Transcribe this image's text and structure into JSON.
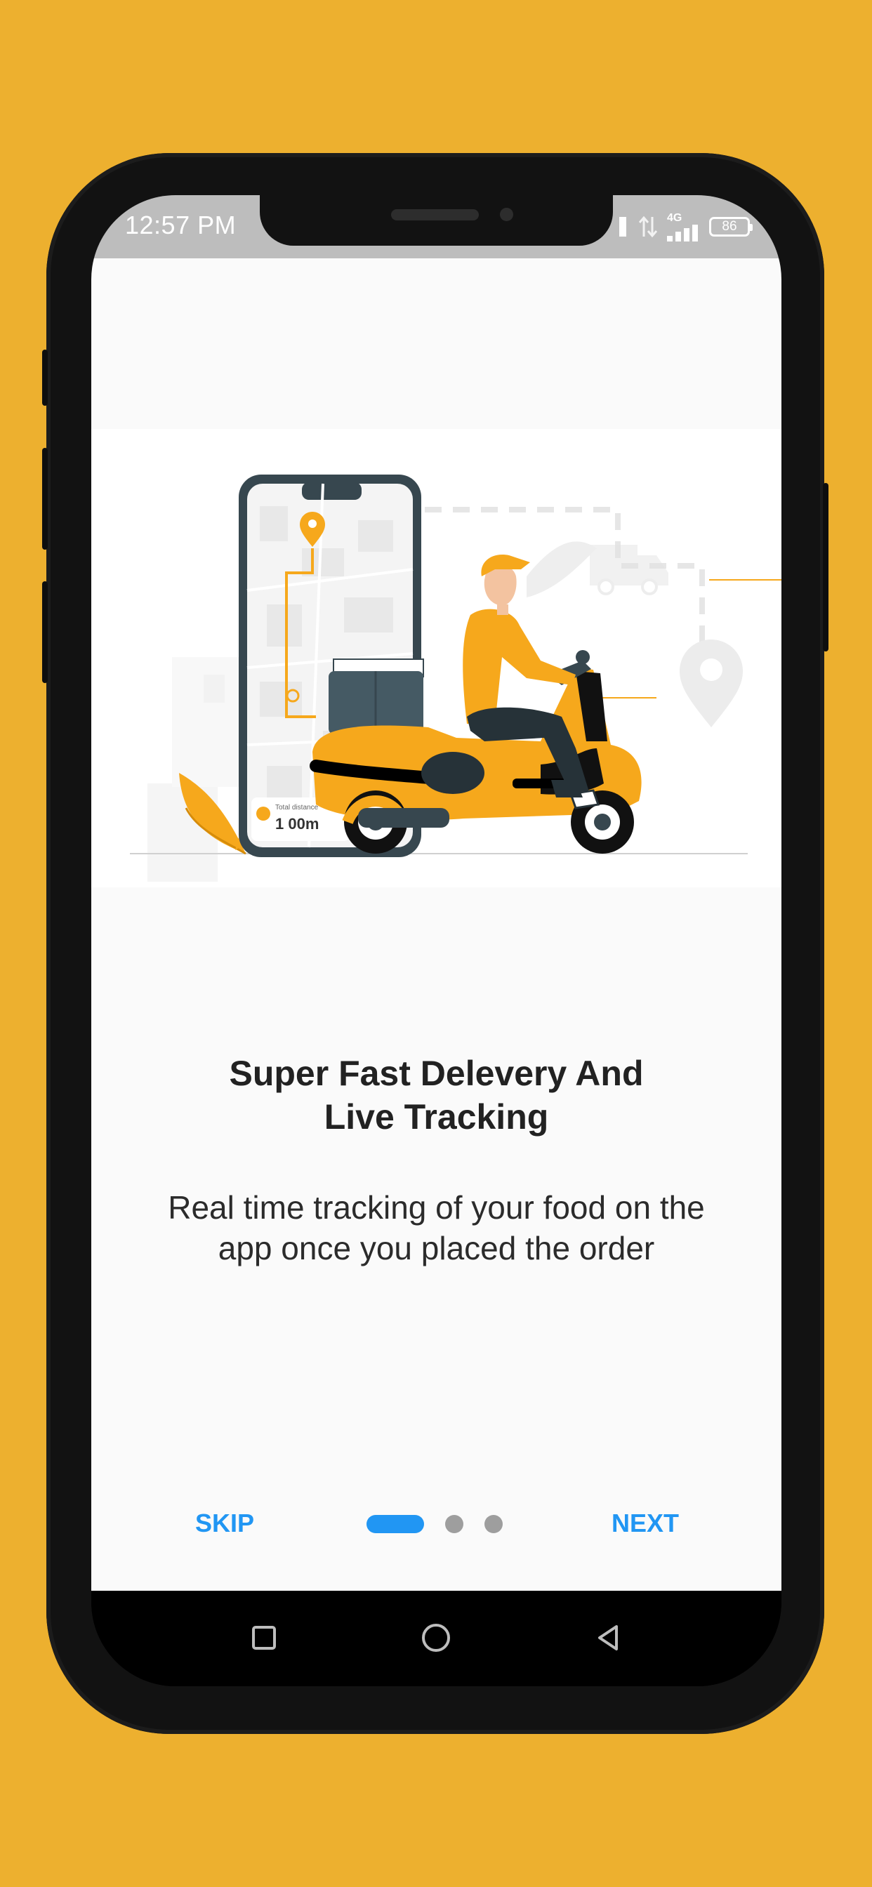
{
  "status_bar": {
    "time": "12:57 PM",
    "network_label": "4G",
    "battery_level": "86",
    "icons": [
      "signal-icon",
      "data-arrows-icon",
      "signal-bars-icon",
      "battery-icon"
    ]
  },
  "onboarding": {
    "illustration": "delivery-scooter-map-illustration",
    "phone_distance_label": "Total distance",
    "phone_distance_value": "1 00m",
    "title_line1": "Super Fast Delevery And",
    "title_line2": "Live Tracking",
    "description_line1": "Real time tracking of your food on the",
    "description_line2": "app once you placed the order",
    "current_page": 1,
    "page_count": 3
  },
  "controls": {
    "skip_label": "SKIP",
    "next_label": "NEXT"
  },
  "nav_bar": {
    "icons": [
      "recents-square-icon",
      "home-circle-icon",
      "back-triangle-icon"
    ]
  },
  "colors": {
    "background": "#EDB02F",
    "accent": "#2196F3",
    "illustration_yellow": "#F6A81C",
    "illustration_dark": "#37474F"
  }
}
